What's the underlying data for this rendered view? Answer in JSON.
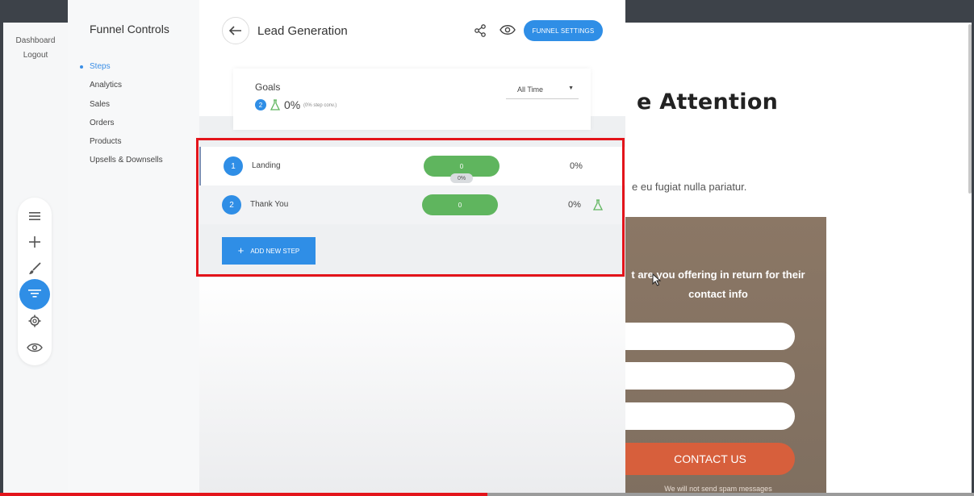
{
  "left_nav": {
    "dashboard": "Dashboard",
    "logout": "Logout"
  },
  "sidebar": {
    "title": "Funnel Controls",
    "items": [
      {
        "label": "Steps",
        "active": true
      },
      {
        "label": "Analytics",
        "active": false
      },
      {
        "label": "Sales",
        "active": false
      },
      {
        "label": "Orders",
        "active": false
      },
      {
        "label": "Products",
        "active": false
      },
      {
        "label": "Upsells & Downsells",
        "active": false
      }
    ]
  },
  "toolbar": {
    "icons": [
      "menu-icon",
      "plus-icon",
      "brush-icon",
      "funnel-filter-icon",
      "gear-icon",
      "eye-icon"
    ],
    "active": "funnel-filter-icon"
  },
  "header": {
    "title": "Lead Generation",
    "settings_label": "FUNNEL SETTINGS",
    "share_icon": "share-icon",
    "preview_icon": "eye-icon"
  },
  "goals": {
    "label": "Goals",
    "count": "2",
    "percent": "0%",
    "conversion": "(0% step conv.)",
    "range_value": "All Time"
  },
  "steps": [
    {
      "number": "1",
      "name": "Landing",
      "count": "0",
      "tag": "0%",
      "percent": "0%"
    },
    {
      "number": "2",
      "name": "Thank You",
      "count": "0",
      "percent": "0%"
    }
  ],
  "add_step_label": "ADD NEW STEP",
  "preview": {
    "headline_partial": "e Attention",
    "body_partial": "e eu fugiat nulla pariatur.",
    "question_line1": "t are you offering in return for their",
    "question_line2": "contact info",
    "button_label": "CONTACT US",
    "spam_note": "We will not send spam messages"
  },
  "video_progress": 0.5,
  "colors": {
    "accent": "#2f8ee6",
    "success": "#5fb55e",
    "highlight": "#e3141b",
    "cta": "#d75f3c"
  }
}
